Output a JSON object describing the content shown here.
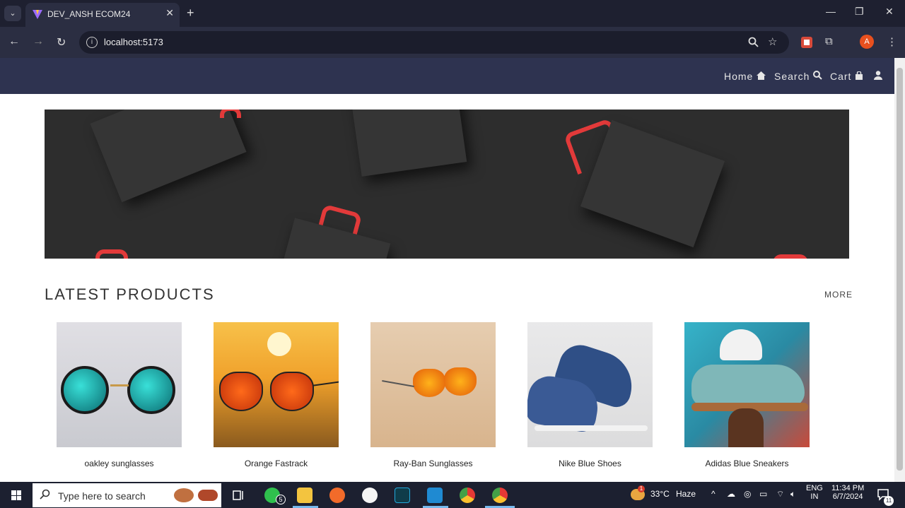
{
  "browser": {
    "tab_title": "DEV_ANSH ECOM24",
    "tab_close": "✕",
    "new_tab": "+",
    "url": "localhost:5173",
    "profile_initial": "A",
    "tab_switcher": "⌄"
  },
  "site": {
    "nav": {
      "home": "Home",
      "search": "Search",
      "cart": "Cart"
    },
    "section_title": "LATEST PRODUCTS",
    "more": "MORE",
    "products": [
      {
        "name": "oakley sunglasses"
      },
      {
        "name": "Orange Fastrack"
      },
      {
        "name": "Ray-Ban Sunglasses"
      },
      {
        "name": "Nike Blue Shoes"
      },
      {
        "name": "Adidas Blue Sneakers"
      }
    ]
  },
  "taskbar": {
    "search_placeholder": "Type here to search",
    "whatsapp_badge": "5",
    "temperature": "33°C",
    "weather": "Haze",
    "weather_alert": "1",
    "lang_top": "ENG",
    "lang_bottom": "IN",
    "time": "11:34 PM",
    "date": "6/7/2024",
    "notifications": "11"
  },
  "colors": {
    "site_nav_bg": "#2e3350",
    "browser_bg": "#1e2030",
    "accent_red": "#e23a3a"
  }
}
